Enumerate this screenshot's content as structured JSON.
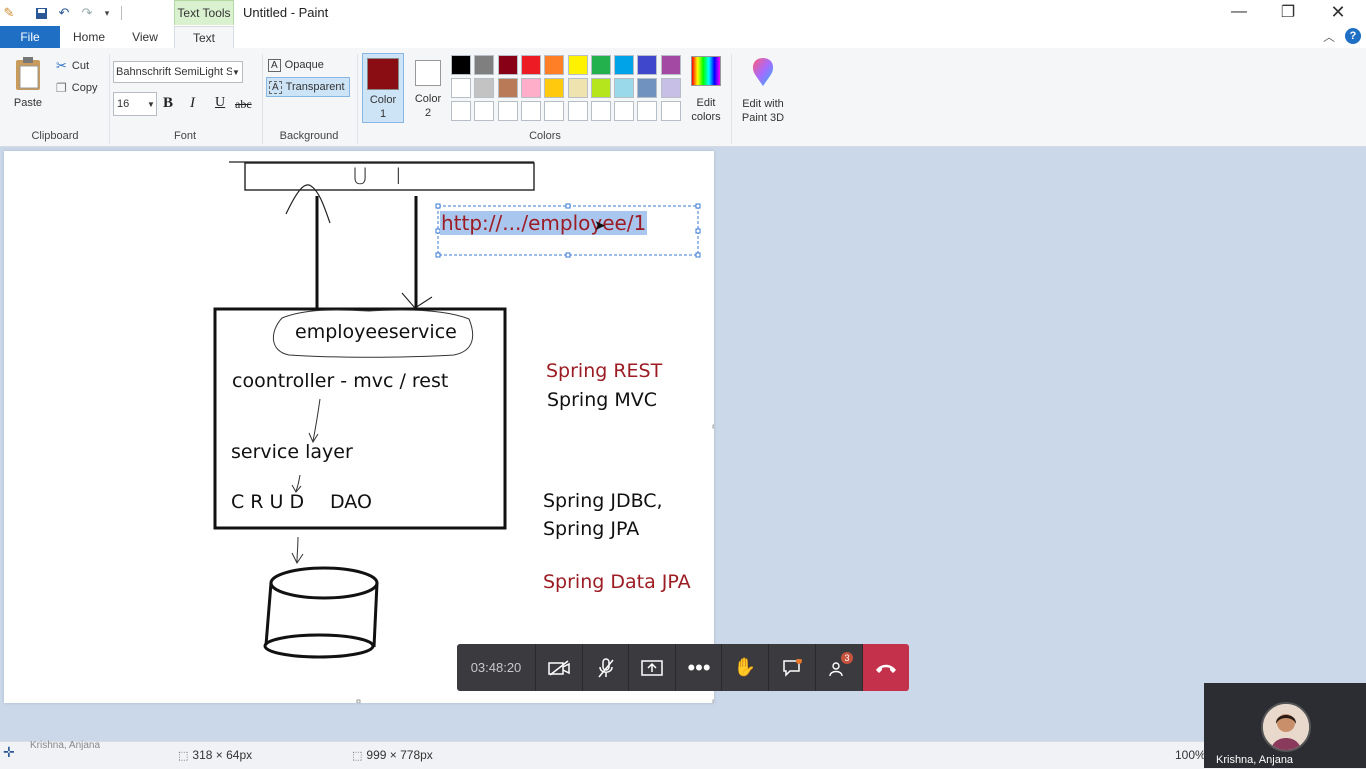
{
  "window": {
    "title": "Untitled - Paint",
    "context_tab": "Text Tools"
  },
  "tabs": {
    "file": "File",
    "home": "Home",
    "view": "View",
    "text": "Text"
  },
  "clipboard": {
    "paste": "Paste",
    "cut": "Cut",
    "copy": "Copy",
    "group": "Clipboard"
  },
  "font": {
    "family": "Bahnschrift SemiLight S",
    "size": "16",
    "bold": "B",
    "italic": "I",
    "underline": "U",
    "strike": "abc",
    "group": "Font"
  },
  "background": {
    "opaque": "Opaque",
    "transparent": "Transparent",
    "group": "Background"
  },
  "colors": {
    "color1_label": "Color 1",
    "color2_label": "Color 2",
    "color1_value": "#8a0d14",
    "color2_value": "#ffffff",
    "edit": "Edit colors",
    "group": "Colors",
    "palette_row1": [
      "#000000",
      "#7f7f7f",
      "#880015",
      "#ed1c24",
      "#ff7f27",
      "#fff200",
      "#22b14c",
      "#00a2e8",
      "#3f48cc",
      "#a349a4"
    ],
    "palette_row2": [
      "#ffffff",
      "#c3c3c3",
      "#b97a57",
      "#ffaec9",
      "#ffc90e",
      "#efe4b0",
      "#b5e61d",
      "#99d9ea",
      "#7092be",
      "#c8bfe7"
    ]
  },
  "paint3d": {
    "label": "Edit with Paint 3D"
  },
  "drawing": {
    "ui_box": "U I",
    "url_text": "http://.../employee/1",
    "service": "employeeservice",
    "controller": "coontroller - mvc / rest",
    "service_layer": "service layer",
    "crud": "C R U D",
    "dao": "DAO",
    "spring_rest": "Spring REST",
    "spring_mvc": "Spring MVC",
    "spring_jdbc": "Spring JDBC,",
    "spring_jpa": "Spring JPA",
    "spring_data_jpa": "Spring Data JPA",
    "accent_red": "#9c1c24"
  },
  "status": {
    "selection_size": "318 × 64px",
    "image_size": "999 × 778px",
    "zoom": "100%",
    "overlay_name": "Krishna, Anjana"
  },
  "call": {
    "timer": "03:48:20",
    "participants_badge": "3"
  },
  "video": {
    "name": "Krishna, Anjana"
  }
}
